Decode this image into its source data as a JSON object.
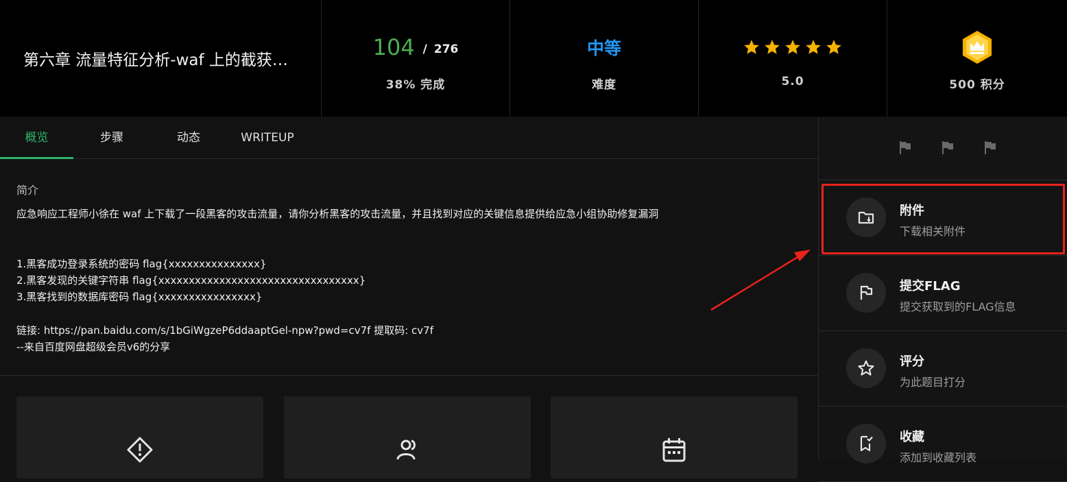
{
  "header": {
    "title": "第六章 流量特征分析-waf 上的截获的黑客攻击流量",
    "progress": {
      "done": "104",
      "separator": "/",
      "total": "276",
      "label": "38% 完成",
      "percent": 38
    },
    "difficulty": {
      "value": "中等",
      "label": "难度"
    },
    "rating": {
      "stars": 5,
      "label": "5.0"
    },
    "points": {
      "label": "500 积分"
    }
  },
  "tabs": [
    {
      "label": "概览"
    },
    {
      "label": "步骤"
    },
    {
      "label": "动态"
    },
    {
      "label": "WRITEUP"
    }
  ],
  "intro": {
    "label": "简介",
    "lines": [
      "应急响应工程师小徐在 waf 上下载了一段黑客的攻击流量，请你分析黑客的攻击流量，并且找到对应的关键信息提供给应急小组协助修复漏洞",
      "",
      "",
      "1.黑客成功登录系统的密码 flag{xxxxxxxxxxxxxxx}",
      "2.黑客发现的关键字符串 flag{xxxxxxxxxxxxxxxxxxxxxxxxxxxxxxxxx}",
      "3.黑客找到的数据库密码 flag{xxxxxxxxxxxxxxxx}",
      "",
      "链接: https://pan.baidu.com/s/1bGiWgzeP6ddaaptGel-npw?pwd=cv7f 提取码: cv7f",
      "--来自百度网盘超级会员v6的分享"
    ]
  },
  "cards": [
    {
      "icon": "warning-diamond-icon"
    },
    {
      "icon": "users-icon"
    },
    {
      "icon": "calendar-icon"
    }
  ],
  "sidebar": {
    "flag_icons": [
      "flag-icon",
      "flag-icon",
      "flag-icon"
    ],
    "items": [
      {
        "title": "附件",
        "subtitle": "下载相关附件",
        "icon": "folder-icon"
      },
      {
        "title": "提交FLAG",
        "subtitle": "提交获取到的FLAG信息",
        "icon": "flag-icon"
      },
      {
        "title": "评分",
        "subtitle": "为此题目打分",
        "icon": "star-icon"
      },
      {
        "title": "收藏",
        "subtitle": "添加到收藏列表",
        "icon": "bookmark-icon"
      }
    ]
  },
  "colors": {
    "accent_green": "#2fb36a",
    "difficulty_blue": "#2196f3",
    "star_gold": "#f5b301",
    "annotation_red": "#e8231a"
  }
}
